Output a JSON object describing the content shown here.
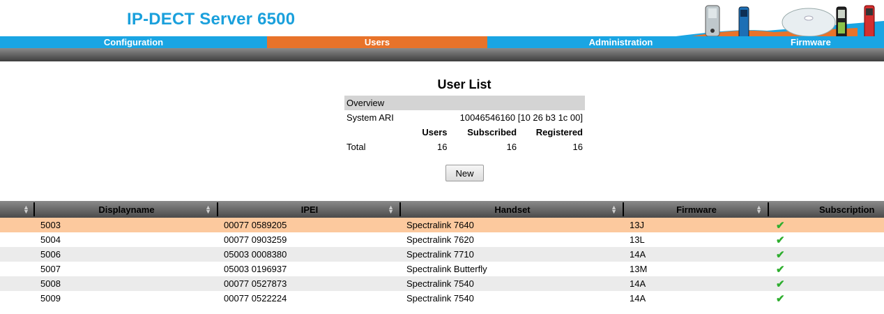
{
  "app_title": "IP-DECT Server 6500",
  "nav": {
    "tabs": [
      {
        "label": "Configuration",
        "active": false
      },
      {
        "label": "Users",
        "active": true
      },
      {
        "label": "Administration",
        "active": false
      },
      {
        "label": "Firmware",
        "active": false
      }
    ]
  },
  "colors": {
    "nav_blue": "#1aa5e3",
    "nav_active": "#e8732a",
    "title_blue": "#1aa0dc",
    "row_selected": "#fcc99e",
    "check_green": "#2eae2e"
  },
  "user_list": {
    "title": "User List",
    "overview_label": "Overview",
    "system_ari_label": "System ARI",
    "system_ari_value": "10046546160 [10 26 b3 1c 00]",
    "col_users": "Users",
    "col_subscribed": "Subscribed",
    "col_registered": "Registered",
    "total_label": "Total",
    "total_users": "16",
    "total_subscribed": "16",
    "total_registered": "16",
    "new_button": "New"
  },
  "table": {
    "headers": [
      "Displayname",
      "IPEI",
      "Handset",
      "Firmware",
      "Subscription"
    ],
    "rows": [
      {
        "displayname": "5003",
        "ipei": "00077 0589205",
        "handset": "Spectralink 7640",
        "firmware": "13J",
        "subscribed": true,
        "selected": true
      },
      {
        "displayname": "5004",
        "ipei": "00077 0903259",
        "handset": "Spectralink 7620",
        "firmware": "13L",
        "subscribed": true
      },
      {
        "displayname": "5006",
        "ipei": "05003 0008380",
        "handset": "Spectralink 7710",
        "firmware": "14A",
        "subscribed": true
      },
      {
        "displayname": "5007",
        "ipei": "05003 0196937",
        "handset": "Spectralink Butterfly",
        "firmware": "13M",
        "subscribed": true
      },
      {
        "displayname": "5008",
        "ipei": "00077 0527873",
        "handset": "Spectralink 7540",
        "firmware": "14A",
        "subscribed": true
      },
      {
        "displayname": "5009",
        "ipei": "00077 0522224",
        "handset": "Spectralink 7540",
        "firmware": "14A",
        "subscribed": true
      }
    ],
    "check_icon": "checkmark-icon",
    "sort_icon": "sort-arrows-icon"
  }
}
